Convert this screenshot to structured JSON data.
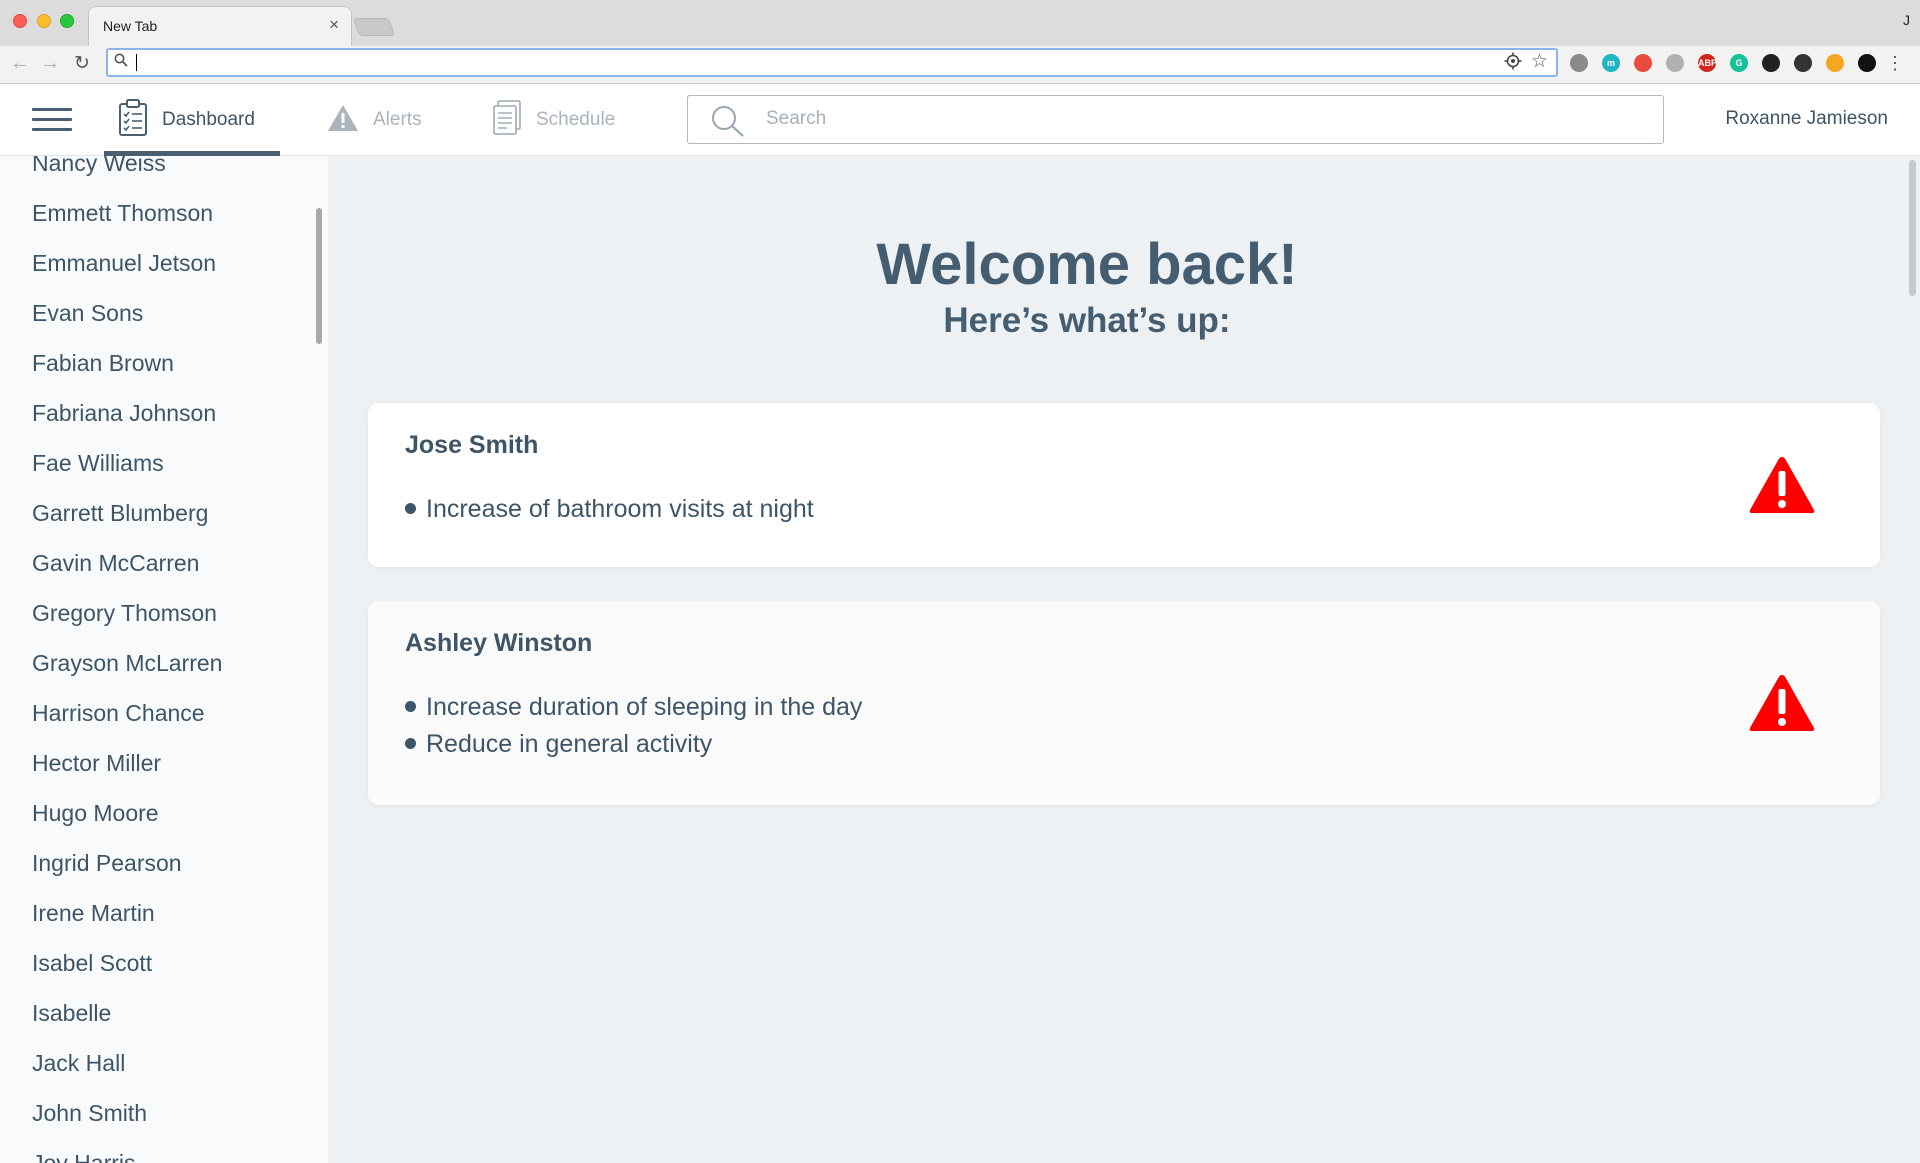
{
  "browser": {
    "tab_title": "New Tab",
    "tab_close": "×",
    "profile_letter": "J",
    "omnibox_value": "",
    "extensions": [
      {
        "name": "ext-grey",
        "color": "#8a8a8a",
        "text": ""
      },
      {
        "name": "ext-teal",
        "color": "#1fb5c4",
        "text": "m"
      },
      {
        "name": "ext-colorwheel",
        "color": "#e94b3c",
        "text": ""
      },
      {
        "name": "ext-grey-2",
        "color": "#b0b0b0",
        "text": ""
      },
      {
        "name": "ext-abp",
        "color": "#d0281c",
        "text": "ABP"
      },
      {
        "name": "ext-grammarly",
        "color": "#15c39a",
        "text": "G"
      },
      {
        "name": "ext-bird",
        "color": "#222222",
        "text": ""
      },
      {
        "name": "ext-dark",
        "color": "#333333",
        "text": ""
      },
      {
        "name": "ext-rainbow",
        "color": "#f5a623",
        "text": ""
      },
      {
        "name": "ext-ring",
        "color": "#111111",
        "text": ""
      }
    ]
  },
  "header": {
    "tabs": [
      {
        "label": "Dashboard",
        "active": true
      },
      {
        "label": "Alerts",
        "active": false
      },
      {
        "label": "Schedule",
        "active": false
      }
    ],
    "search_placeholder": "Search",
    "user_name": "Roxanne Jamieson"
  },
  "sidebar": {
    "items": [
      "Nancy Weiss",
      "Emmett Thomson",
      "Emmanuel Jetson",
      "Evan Sons",
      "Fabian Brown",
      "Fabriana Johnson",
      "Fae Williams",
      "Garrett Blumberg",
      "Gavin McCarren",
      "Gregory Thomson",
      "Grayson McLarren",
      "Harrison Chance",
      "Hector Miller",
      "Hugo Moore",
      "Ingrid Pearson",
      "Irene Martin",
      "Isabel Scott",
      "Isabelle",
      "Jack Hall",
      "John Smith",
      "Joy Harris"
    ]
  },
  "main": {
    "welcome": "Welcome back!",
    "subtitle": "Here’s what’s up:",
    "alerts": [
      {
        "name": "Jose Smith",
        "items": [
          "Increase of bathroom visits at night"
        ]
      },
      {
        "name": "Ashley Winston",
        "items": [
          "Increase duration of sleeping in the day",
          "Reduce in general activity"
        ]
      }
    ]
  },
  "colors": {
    "text_primary": "#3e5567",
    "text_muted": "#aab4bd",
    "warning_red": "#ff0000",
    "background": "#eef1f4"
  }
}
